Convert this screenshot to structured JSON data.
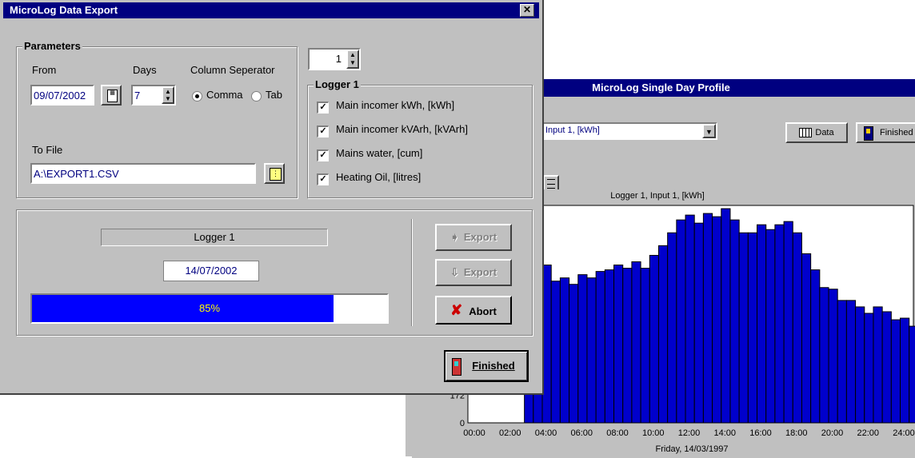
{
  "profile_window": {
    "title": "MicroLog Single Day Profile",
    "channel_select": "Input 1, [kWh]",
    "data_label": "Data",
    "finished_label": "Finished"
  },
  "export_dialog": {
    "title": "MicroLog Data Export",
    "parameters_label": "Parameters",
    "from_label": "From",
    "from_value": "09/07/2002",
    "days_label": "Days",
    "days_value": "7",
    "separator_label": "Column Seperator",
    "comma_label": "Comma",
    "tab_label": "Tab",
    "separator_selected": "Comma",
    "to_file_label": "To File",
    "to_file_value": "A:\\EXPORT1.CSV",
    "logger_spin_value": "1",
    "logger_group_label": "Logger 1",
    "channels": [
      {
        "label": "Main incomer kWh, [kWh]",
        "checked": true
      },
      {
        "label": "Main incomer kVArh, [kVArh]",
        "checked": true
      },
      {
        "label": "Mains water, [cum]",
        "checked": true
      },
      {
        "label": "Heating Oil, [litres]",
        "checked": true
      }
    ],
    "status_logger": "Logger 1",
    "status_date": "14/07/2002",
    "progress_text": "85%",
    "progress_value": 0.85,
    "export_btn_1": "Export",
    "export_btn_2": "Export",
    "abort_label": "Abort",
    "finished_label": "Finished",
    "colors": {
      "titlebar": "#000080",
      "progress": "#0000ff",
      "face": "#c0c0c0",
      "abort_x": "#cc0000"
    }
  },
  "chart_data": {
    "type": "bar",
    "title": "Logger 1, Input 1, [kWh]",
    "xlabel": "Friday, 14/03/1997",
    "x_ticks": [
      "00:00",
      "02:00",
      "04:00",
      "06:00",
      "08:00",
      "10:00",
      "12:00",
      "14:00",
      "16:00",
      "18:00",
      "20:00",
      "22:00",
      "24:00"
    ],
    "y_ticks": [
      "0",
      "172"
    ],
    "xlim": [
      0,
      24
    ],
    "ylim": [
      0,
      1350
    ],
    "bar_color": "#0000cc",
    "x_start": 2.8,
    "interval_hours": 0.5,
    "values": [
      1000,
      1020,
      980,
      880,
      900,
      860,
      920,
      900,
      940,
      950,
      980,
      960,
      1000,
      960,
      1040,
      1100,
      1180,
      1260,
      1290,
      1240,
      1300,
      1280,
      1330,
      1260,
      1180,
      1180,
      1230,
      1200,
      1230,
      1250,
      1180,
      1050,
      950,
      840,
      830,
      760,
      760,
      720,
      680,
      720,
      690,
      640,
      650,
      600,
      610,
      580,
      560,
      560
    ]
  }
}
